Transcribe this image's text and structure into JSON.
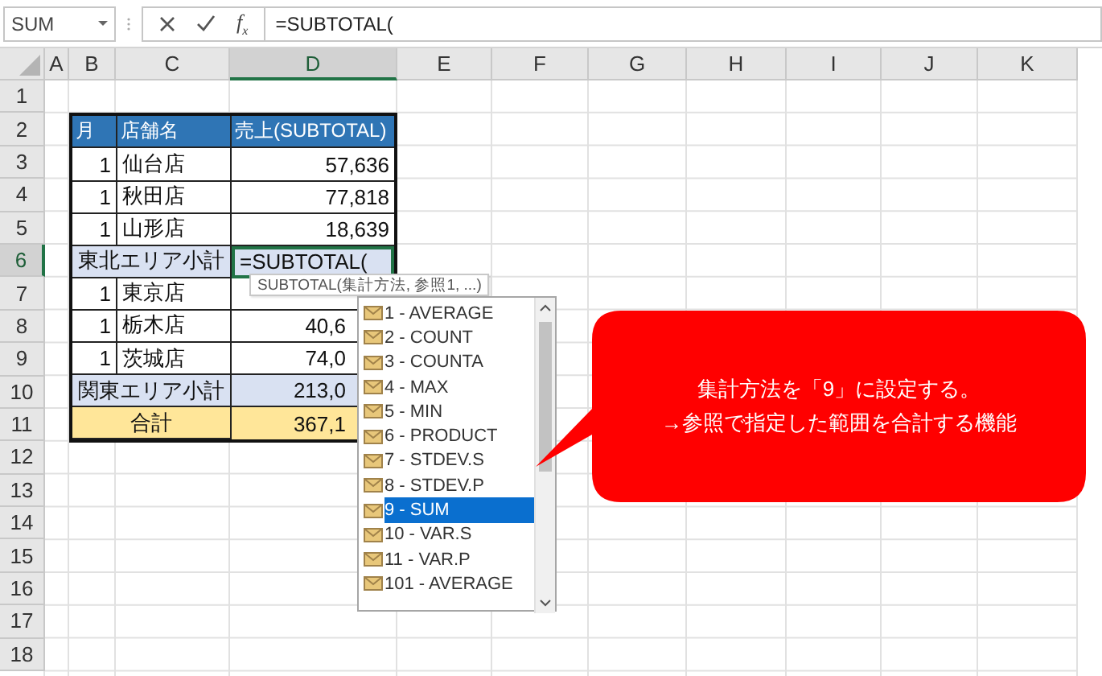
{
  "name_box": {
    "value": "SUM"
  },
  "formula_bar": {
    "function_label": "f$_{x}$",
    "formula": "=SUBTOTAL("
  },
  "columns": [
    {
      "label": "A",
      "selected": false
    },
    {
      "label": "B",
      "selected": false
    },
    {
      "label": "C",
      "selected": false
    },
    {
      "label": "D",
      "selected": true
    },
    {
      "label": "E",
      "selected": false
    },
    {
      "label": "F",
      "selected": false
    },
    {
      "label": "G",
      "selected": false
    },
    {
      "label": "H",
      "selected": false
    },
    {
      "label": "I",
      "selected": false
    },
    {
      "label": "J",
      "selected": false
    },
    {
      "label": "K",
      "selected": false
    }
  ],
  "rows": [
    {
      "label": "1",
      "selected": false
    },
    {
      "label": "2",
      "selected": false
    },
    {
      "label": "3",
      "selected": false
    },
    {
      "label": "4",
      "selected": false
    },
    {
      "label": "5",
      "selected": false
    },
    {
      "label": "6",
      "selected": true
    },
    {
      "label": "7",
      "selected": false
    },
    {
      "label": "8",
      "selected": false
    },
    {
      "label": "9",
      "selected": false
    },
    {
      "label": "10",
      "selected": false
    },
    {
      "label": "11",
      "selected": false
    },
    {
      "label": "12",
      "selected": false
    },
    {
      "label": "13",
      "selected": false
    },
    {
      "label": "14",
      "selected": false
    },
    {
      "label": "15",
      "selected": false
    },
    {
      "label": "16",
      "selected": false
    },
    {
      "label": "17",
      "selected": false
    },
    {
      "label": "18",
      "selected": false
    }
  ],
  "table": {
    "header": [
      "月",
      "店舗名",
      "売上(SUBTOTAL)"
    ],
    "rows": [
      {
        "kind": "item",
        "month": "1",
        "store": "仙台店",
        "sales": "57,636",
        "active": false
      },
      {
        "kind": "item",
        "month": "1",
        "store": "秋田店",
        "sales": "77,818",
        "active": false
      },
      {
        "kind": "item",
        "month": "1",
        "store": "山形店",
        "sales": "18,639",
        "active": false
      },
      {
        "kind": "subtotal",
        "label": "東北エリア小計",
        "sales": "=SUBTOTAL(",
        "active": true
      },
      {
        "kind": "item",
        "month": "1",
        "store": "東京店",
        "active": false
      },
      {
        "kind": "item",
        "month": "1",
        "store": "栃木店",
        "sales": "40,6",
        "active": false
      },
      {
        "kind": "item",
        "month": "1",
        "store": "茨城店",
        "sales": "74,0",
        "active": false
      },
      {
        "kind": "subtotal",
        "label": "関東エリア小計",
        "sales": "213,0",
        "active": false
      },
      {
        "kind": "total",
        "label": "合計",
        "sales": "367,1",
        "active": false
      }
    ]
  },
  "tooltip": "SUBTOTAL(集計方法, 参照1, ...)",
  "autocomplete": [
    {
      "label": "1 - AVERAGE",
      "selected": false
    },
    {
      "label": "2 - COUNT",
      "selected": false
    },
    {
      "label": "3 - COUNTA",
      "selected": false
    },
    {
      "label": "4 - MAX",
      "selected": false
    },
    {
      "label": "5 - MIN",
      "selected": false
    },
    {
      "label": "6 - PRODUCT",
      "selected": false
    },
    {
      "label": "7 - STDEV.S",
      "selected": false
    },
    {
      "label": "8 - STDEV.P",
      "selected": false
    },
    {
      "label": "9 - SUM",
      "selected": true
    },
    {
      "label": "10 - VAR.S",
      "selected": false
    },
    {
      "label": "11 - VAR.P",
      "selected": false
    },
    {
      "label": "101 - AVERAGE",
      "selected": false
    }
  ],
  "callout": [
    "集計方法を「9」に設定する。",
    "→参照で指定した範囲を合計する機能"
  ]
}
